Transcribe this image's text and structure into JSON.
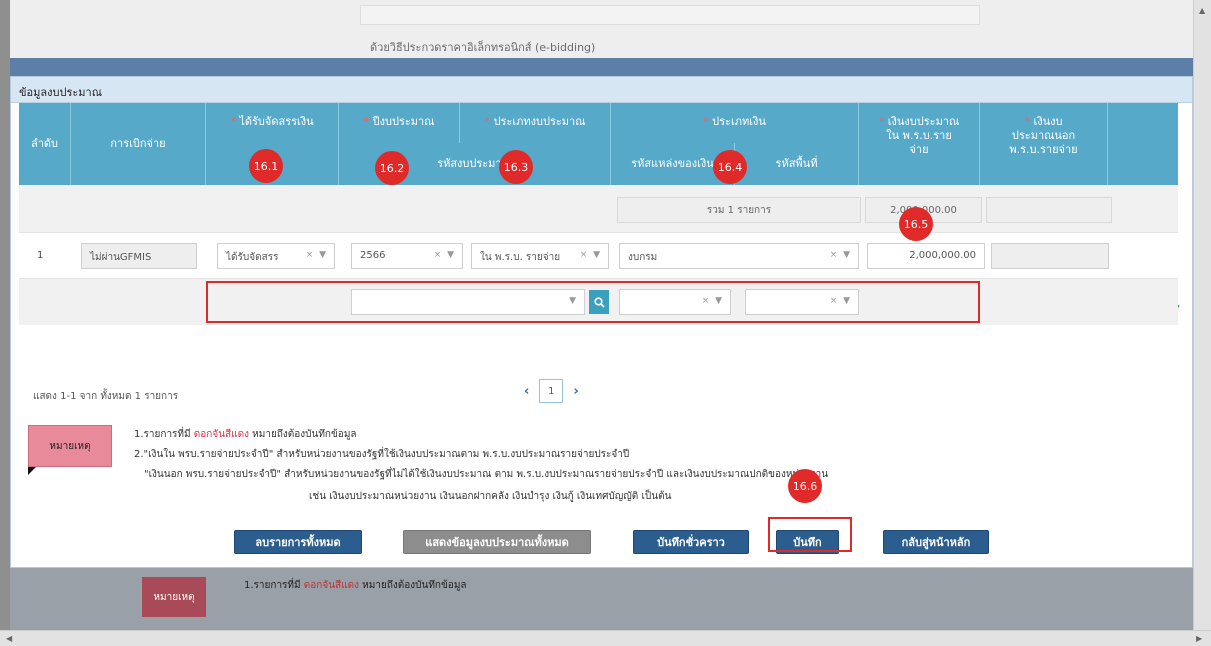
{
  "background": {
    "method_text": "ด้วยวิธีประกวดราคาอิเล็กทรอนิกส์ (e-bidding)",
    "note_badge": "หมายเหตุ",
    "note_prefix": "1.รายการที่มี ",
    "note_red": "ดอกจันสีแดง",
    "note_suffix": " หมายถึงต้องบันทึกข้อมูล"
  },
  "modal": {
    "title": "ข้อมูลงบประมาณ",
    "headers": {
      "seq": "ลำดับ",
      "disbursement": "การเบิกจ่าย",
      "allocation": "ได้รับจัดสรรเงิน",
      "budget_year": "ปีงบประมาณ",
      "budget_type": "ประเภทงบประมาณ",
      "money_type": "ประเภทเงิน",
      "budget_in_act": "เงินงบประมาณใน พ.ร.บ.รายจ่าย",
      "budget_out_act": "เงินงบประมาณนอก พ.ร.บ.รายจ่าย",
      "budget_code": "รหัสงบประมาณ",
      "source_code": "รหัสแหล่งของเงิน",
      "area_code": "รหัสพื้นที่",
      "required_mark": "*"
    },
    "summary": {
      "total_label": "รวม 1 รายการ",
      "total_amount": "2,000,000.00"
    },
    "row": {
      "seq": "1",
      "disbursement": "ไม่ผ่านGFMIS",
      "allocation": "ได้รับจัดสรร",
      "budget_year": "2566",
      "budget_type": "ใน พ.ร.บ. รายจ่าย",
      "money_type": "งบกรม",
      "amount": "2,000,000.00",
      "clear_glyph": "×",
      "caret_glyph": "▼"
    },
    "pager": {
      "info": "แสดง 1-1 จาก ทั้งหมด 1 รายการ",
      "current": "1",
      "prev": "‹",
      "next": "›"
    },
    "notes": {
      "badge": "หมายเหตุ",
      "line1_prefix": "1.รายการที่มี ",
      "line1_red": "ดอกจันสีแดง",
      "line1_suffix": " หมายถึงต้องบันทึกข้อมูล",
      "line2": "2.\"เงินใน พรบ.รายจ่ายประจำปี\" สำหรับหน่วยงานของรัฐที่ใช้เงินงบประมาณตาม พ.ร.บ.งบประมาณรายจ่ายประจำปี",
      "line3": "\"เงินนอก พรบ.รายจ่ายประจำปี\" สำหรับหน่วยงานของรัฐที่ไม่ได้ใช้เงินงบประมาณ ตาม พ.ร.บ.งบประมาณรายจ่ายประจำปี และเงินงบประมาณปกติของหน่วยงาน",
      "line4": "เช่น เงินงบประมาณหน่วยงาน เงินนอกฝากคลัง เงินบำรุง เงินกู้ เงินเทศบัญญัติ เป็นต้น"
    },
    "buttons": {
      "delete_all": "ลบรายการทั้งหมด",
      "show_all": "แสดงข้อมูลงบประมาณทั้งหมด",
      "save_draft": "บันทึกชั่วคราว",
      "save": "บันทึก",
      "back_home": "กลับสู่หน้าหลัก"
    }
  },
  "callouts": {
    "c1": "16.1",
    "c2": "16.2",
    "c3": "16.3",
    "c4": "16.4",
    "c5": "16.5",
    "c6": "16.6"
  },
  "colors": {
    "header": "#57a9c9",
    "callout": "#e02a2a",
    "button_blue": "#2b5d8f",
    "add_green": "#2e9f2e"
  }
}
